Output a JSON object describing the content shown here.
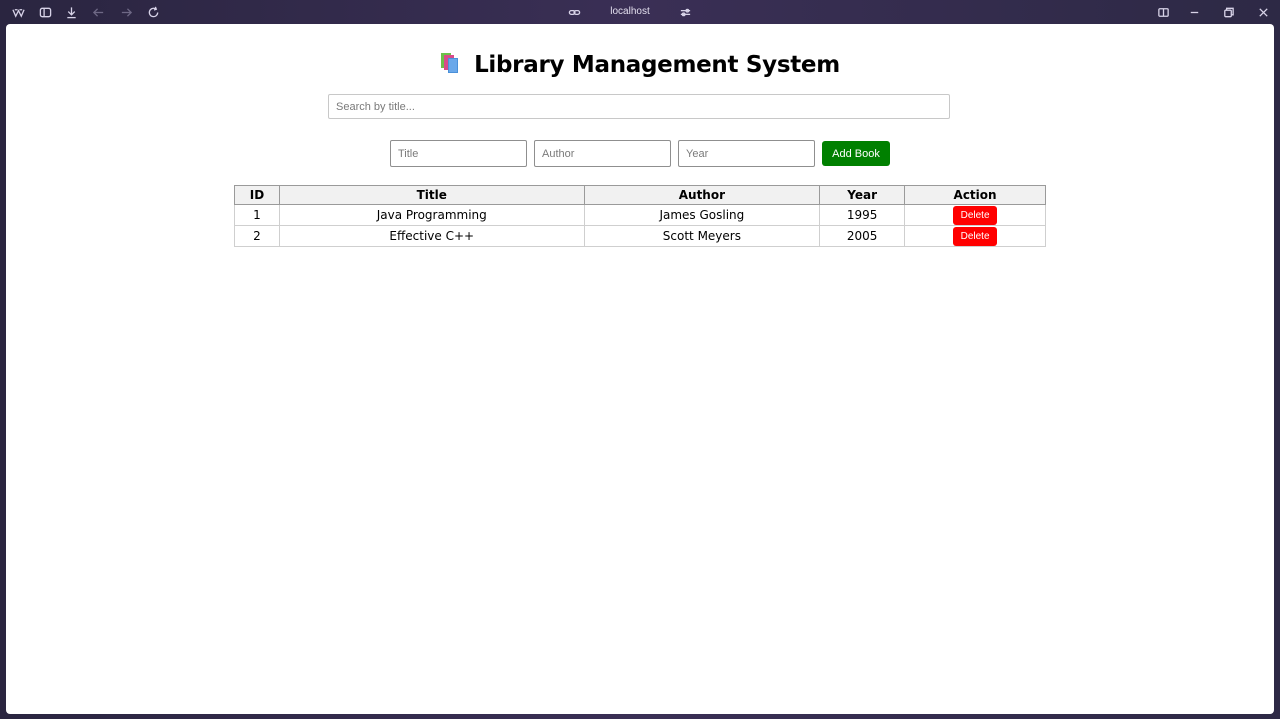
{
  "browser": {
    "url": "localhost",
    "icons": [
      "browser-logo-icon",
      "sidebar-icon",
      "download-icon",
      "back-arrow-icon",
      "forward-arrow-icon",
      "reload-icon",
      "link-icon",
      "tune-icon",
      "split-view-icon",
      "minimize-icon",
      "restore-icon",
      "close-icon"
    ]
  },
  "page": {
    "title": "Library Management System",
    "title_icon": "books-icon",
    "search": {
      "placeholder": "Search by title...",
      "value": ""
    },
    "form": {
      "title_placeholder": "Title",
      "author_placeholder": "Author",
      "year_placeholder": "Year",
      "add_label": "Add Book"
    },
    "table": {
      "headers": [
        "ID",
        "Title",
        "Author",
        "Year",
        "Action"
      ],
      "rows": [
        {
          "id": "1",
          "title": "Java Programming",
          "author": "James Gosling",
          "year": "1995",
          "action": "Delete"
        },
        {
          "id": "2",
          "title": "Effective C++",
          "author": "Scott Meyers",
          "year": "2005",
          "action": "Delete"
        }
      ]
    }
  },
  "colors": {
    "add_button": "#008000",
    "delete_button": "#ff0000"
  }
}
